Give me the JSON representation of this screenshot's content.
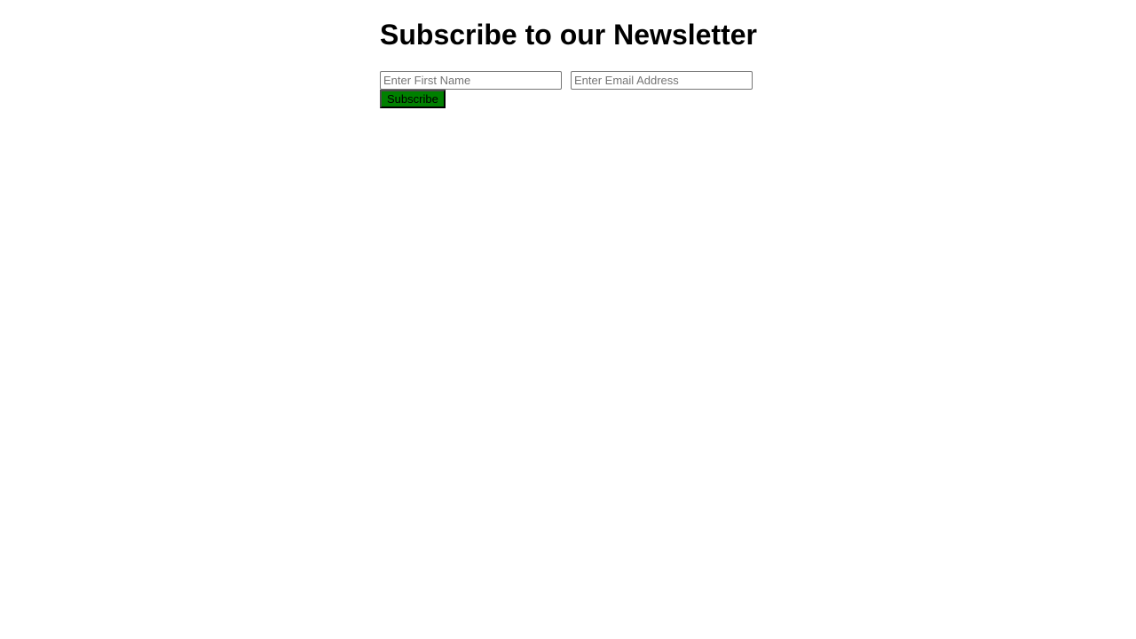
{
  "newsletter": {
    "title": "Subscribe to our Newsletter",
    "first_name_field": {
      "value": "",
      "placeholder": "Enter First Name"
    },
    "email_field": {
      "value": "",
      "placeholder": "Enter Email Address"
    },
    "subscribe_label": "Subscribe"
  },
  "colors": {
    "subscribe_button_background": "#008000",
    "page_background": "#ffffff",
    "title_text": "#000000"
  }
}
